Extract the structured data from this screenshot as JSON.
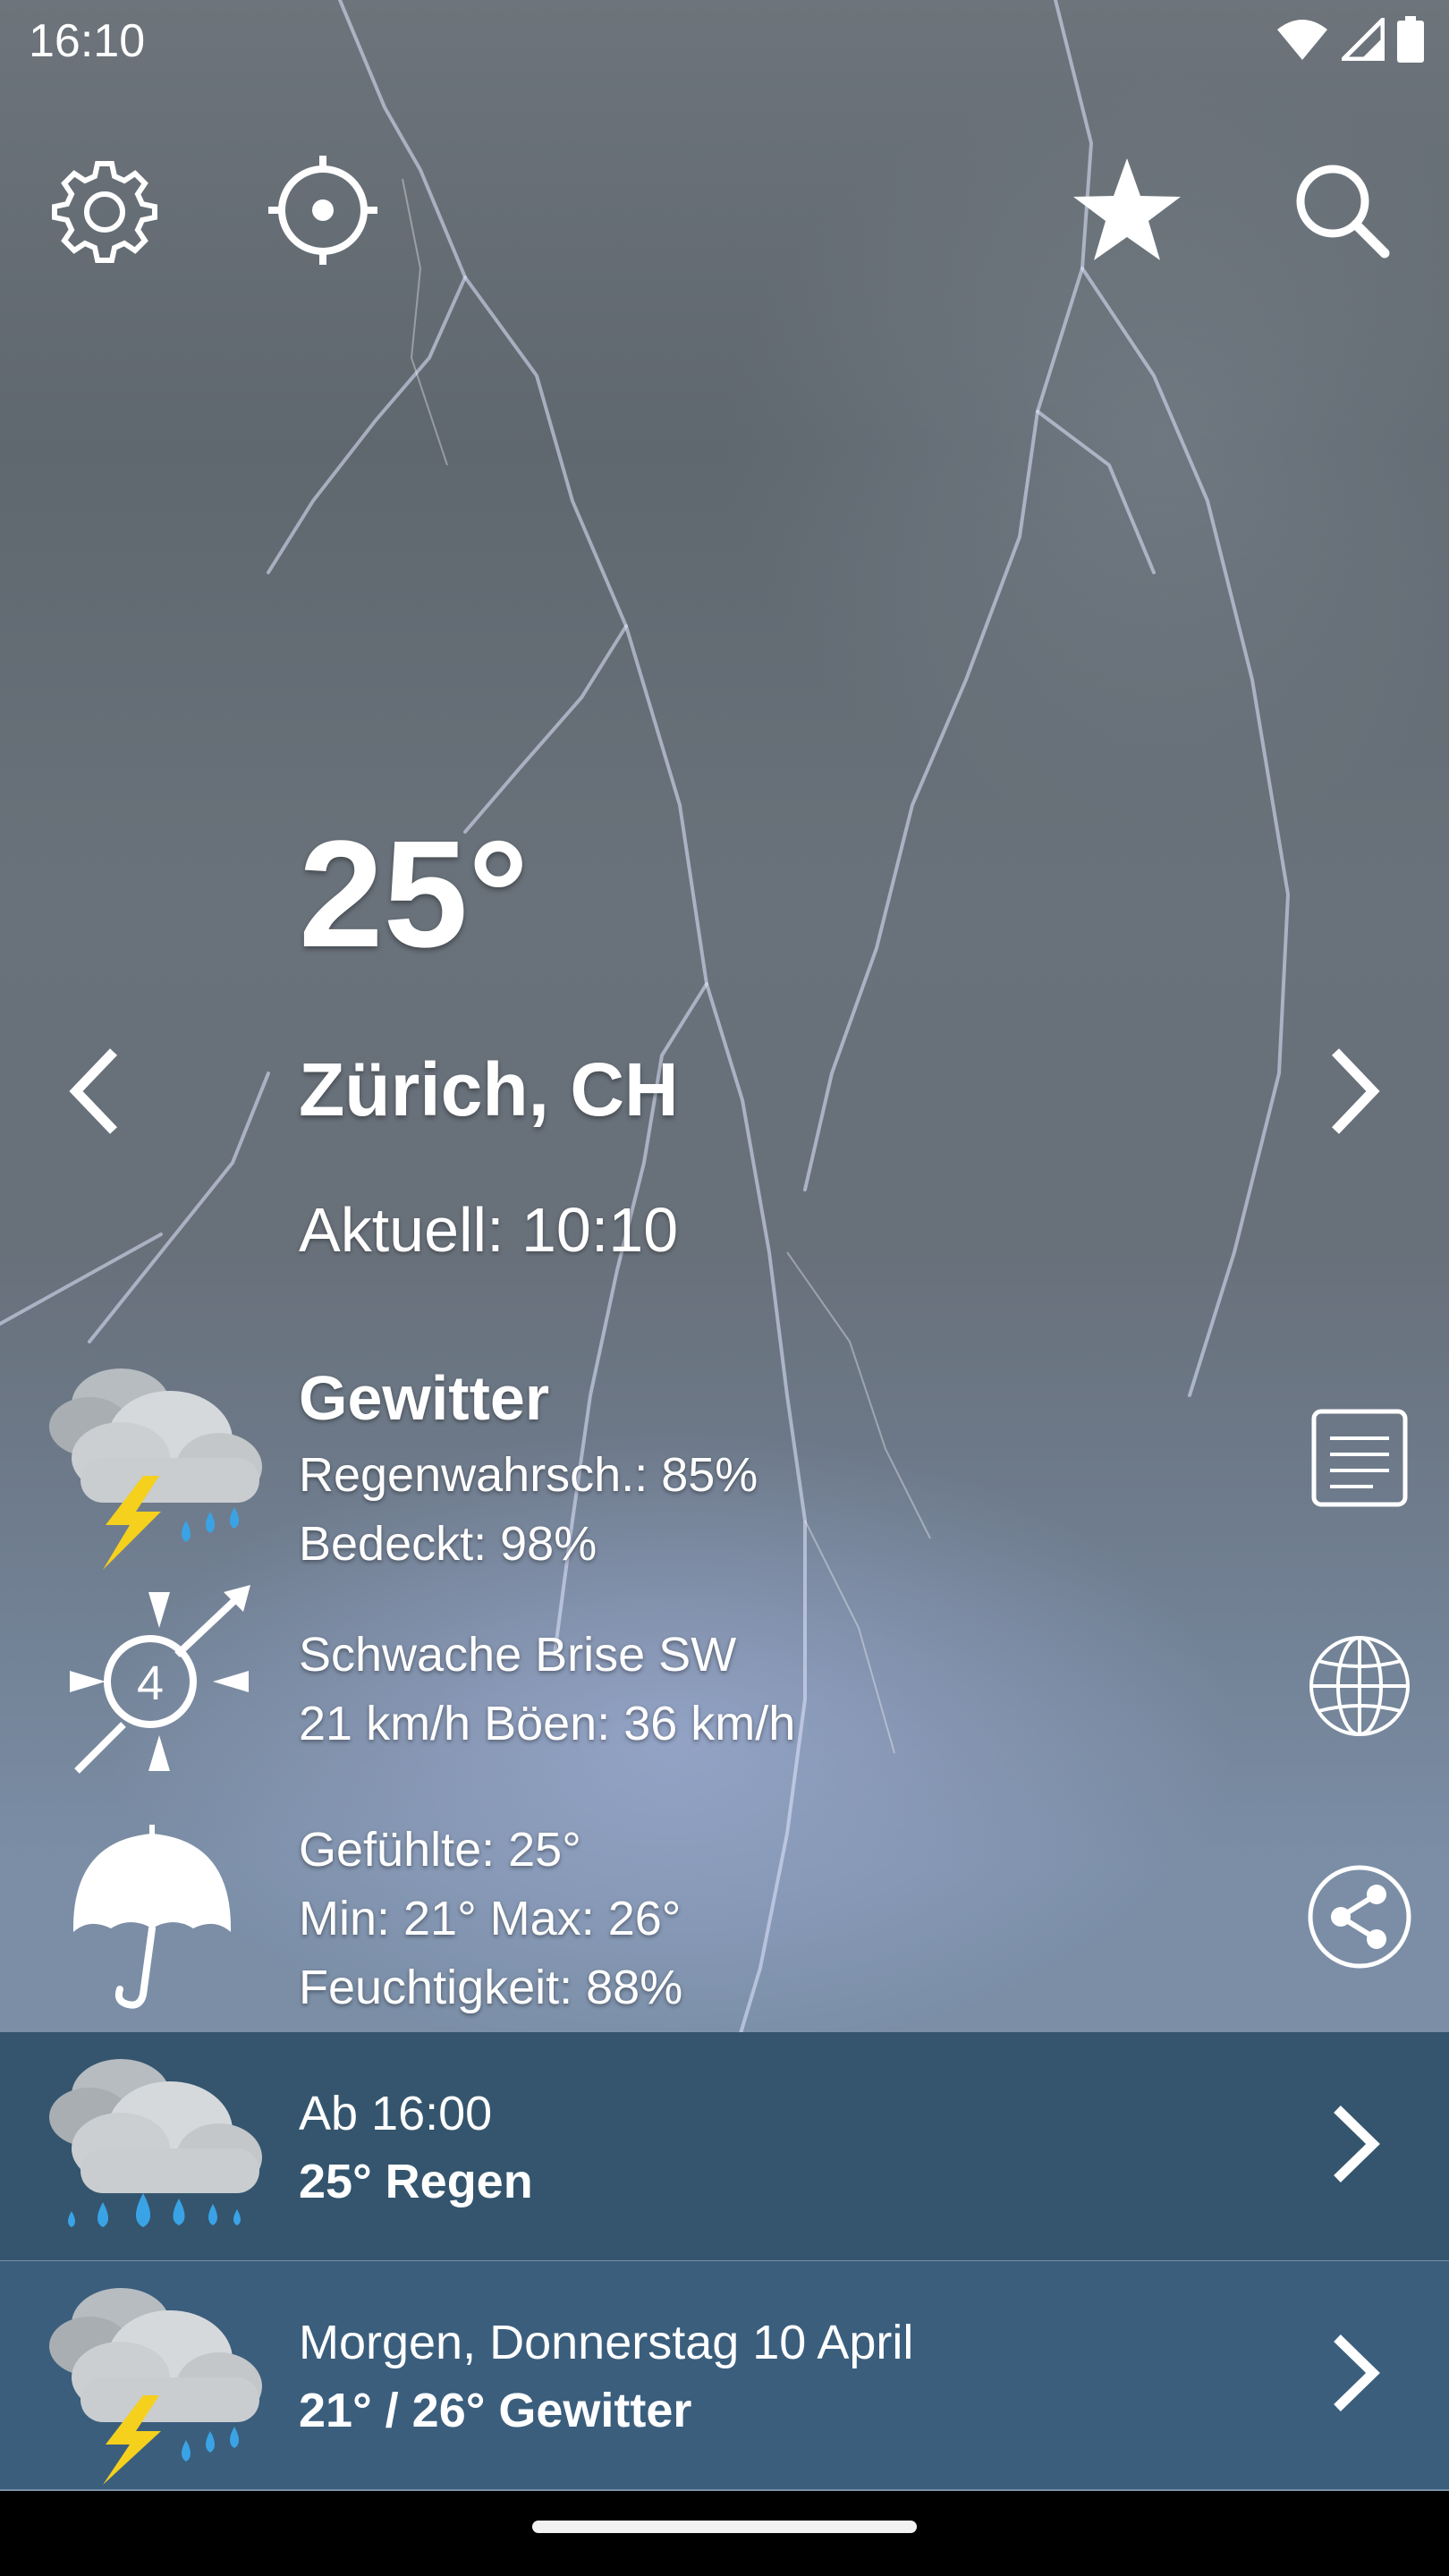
{
  "status_bar": {
    "time": "16:10"
  },
  "current": {
    "temperature": "25°",
    "location": "Zürich, CH",
    "updated": "Aktuell: 10:10"
  },
  "conditions": {
    "title": "Gewitter",
    "rain_probability": "Regenwahrsch.: 85%",
    "cloud_cover": "Bedeckt: 98%"
  },
  "wind": {
    "beaufort": "4",
    "description": "Schwache Brise SW",
    "speed": "21 km/h Böen: 36 km/h"
  },
  "feel": {
    "feels_like": "Gefühlte: 25°",
    "min_max": "Min: 21° Max: 26°",
    "humidity": "Feuchtigkeit: 88%"
  },
  "forecast": [
    {
      "when": "Ab 16:00",
      "summary": "25° Regen",
      "icon": "rain-cloud-icon",
      "bg": "#34556d"
    },
    {
      "when": "Morgen, Donnerstag 10 April",
      "summary": "21° / 26° Gewitter",
      "icon": "thunderstorm-cloud-icon",
      "bg": "#3b5e7d"
    }
  ],
  "colors": {
    "forecast_row_1": "#34556d",
    "forecast_row_2": "#3b5e7d",
    "lightning_yellow": "#f5d01d",
    "rain_blue": "#3aa3e6"
  }
}
